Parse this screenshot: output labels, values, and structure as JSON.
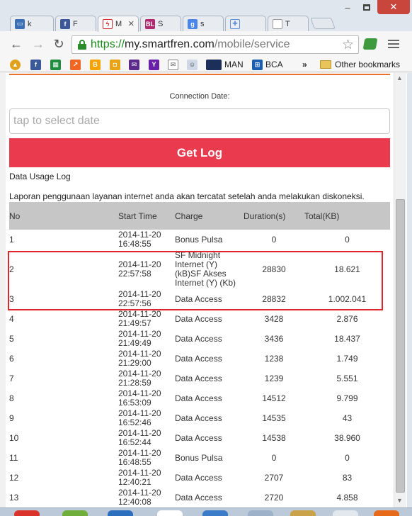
{
  "browser": {
    "tabs": [
      {
        "label": "k",
        "icon": "blog-icon",
        "color": "#3a6fb5"
      },
      {
        "label": "F",
        "icon": "facebook-icon",
        "color": "#3b5998"
      },
      {
        "label": "M",
        "icon": "smartfren-icon",
        "color": "#d0282e",
        "active": true
      },
      {
        "label": "S",
        "icon": "bl-icon",
        "color": "#b0286e"
      },
      {
        "label": "s",
        "icon": "google-icon",
        "color": "#4a86e8"
      },
      {
        "label": "",
        "icon": "puzzle-icon",
        "color": "#5d8fd6"
      },
      {
        "label": "T",
        "icon": "page-icon",
        "color": "#ffffff"
      }
    ],
    "window_controls": {
      "minimize": "–",
      "close": "✕"
    },
    "url": {
      "scheme": "https://",
      "host": "my.smartfren.com",
      "path": "/mobile/service"
    },
    "bookmarks": [
      {
        "label": "MAN",
        "icon": "man-icon",
        "color": "#1c2f5a"
      },
      {
        "label": "BCA",
        "icon": "bca-icon",
        "color": "#1b5fb0"
      }
    ],
    "bookmarks_overflow": "»",
    "other_bookmarks": "Other bookmarks"
  },
  "page": {
    "connection_label": "Connection Date:",
    "date_placeholder": "tap to select date",
    "get_log_label": "Get Log",
    "usage_title": "Data Usage Log",
    "usage_desc": "Laporan penggunaan layanan internet anda akan tercatat setelah anda melakukan diskoneksi.",
    "table": {
      "headers": [
        "No",
        "Start Time",
        "Charge",
        "Duration(s)",
        "Total(KB)"
      ],
      "rows": [
        {
          "no": "1",
          "date": "2014-11-20",
          "time": "16:48:55",
          "charge": "Bonus Pulsa",
          "duration": "0",
          "total": "0"
        },
        {
          "no": "2",
          "date": "2014-11-20",
          "time": "22:57:58",
          "charge": "SF Midnight Internet (Y)(kB)SF Akses Internet (Y) (Kb)",
          "duration": "28830",
          "total": "18.621",
          "tall": true
        },
        {
          "no": "3",
          "date": "2014-11-20",
          "time": "22:57:56",
          "charge": "Data Access",
          "duration": "28832",
          "total": "1.002.041"
        },
        {
          "no": "4",
          "date": "2014-11-20",
          "time": "21:49:57",
          "charge": "Data Access",
          "duration": "3428",
          "total": "2.876"
        },
        {
          "no": "5",
          "date": "2014-11-20",
          "time": "21:49:49",
          "charge": "Data Access",
          "duration": "3436",
          "total": "18.437"
        },
        {
          "no": "6",
          "date": "2014-11-20",
          "time": "21:29:00",
          "charge": "Data Access",
          "duration": "1238",
          "total": "1.749"
        },
        {
          "no": "7",
          "date": "2014-11-20",
          "time": "21:28:59",
          "charge": "Data Access",
          "duration": "1239",
          "total": "5.551"
        },
        {
          "no": "8",
          "date": "2014-11-20",
          "time": "16:53:09",
          "charge": "Data Access",
          "duration": "14512",
          "total": "9.799"
        },
        {
          "no": "9",
          "date": "2014-11-20",
          "time": "16:52:46",
          "charge": "Data Access",
          "duration": "14535",
          "total": "43"
        },
        {
          "no": "10",
          "date": "2014-11-20",
          "time": "16:52:44",
          "charge": "Data Access",
          "duration": "14538",
          "total": "38.960"
        },
        {
          "no": "11",
          "date": "2014-11-20",
          "time": "16:48:55",
          "charge": "Bonus Pulsa",
          "duration": "0",
          "total": "0"
        },
        {
          "no": "12",
          "date": "2014-11-20",
          "time": "12:40:21",
          "charge": "Data Access",
          "duration": "2707",
          "total": "83"
        },
        {
          "no": "13",
          "date": "2014-11-20",
          "time": "12:40:08",
          "charge": "Data Access",
          "duration": "2720",
          "total": "4.858"
        }
      ]
    },
    "highlight_color": "#e0242c",
    "accent_color": "#e93a4e"
  }
}
